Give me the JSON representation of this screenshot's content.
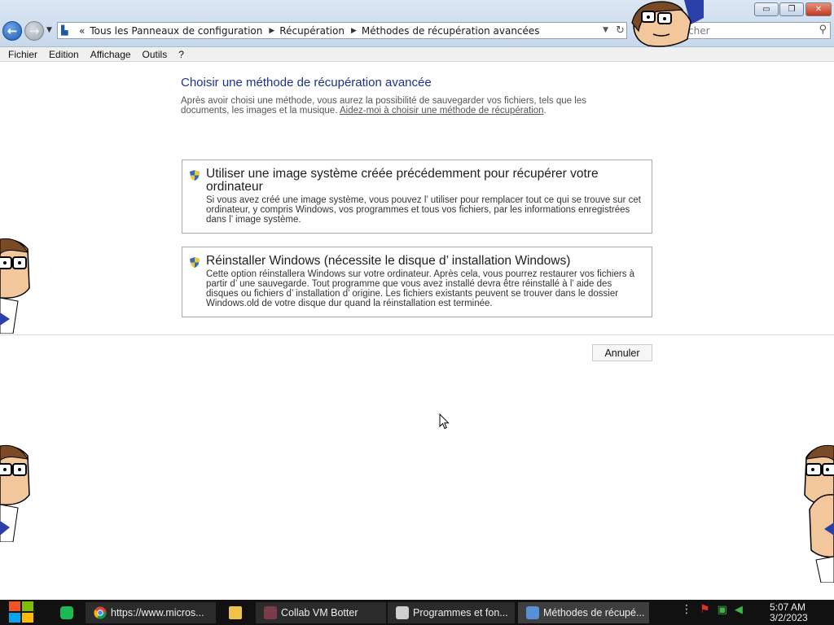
{
  "window": {
    "breadcrumb": {
      "prefix": "«",
      "items": [
        "Tous les Panneaux de configuration",
        "Récupération",
        "Méthodes de récupération avancées"
      ]
    },
    "search_placeholder": "cher",
    "buttons": {
      "minimize": "▭",
      "maximize": "❐",
      "close": "✕"
    }
  },
  "menu": [
    "Fichier",
    "Edition",
    "Affichage",
    "Outils",
    "?"
  ],
  "page": {
    "heading": "Choisir une méthode de récupération avancée",
    "intro": "Après avoir choisi une méthode, vous aurez la possibilité de sauvegarder vos fichiers, tels que les documents, les images et la musique. ",
    "help_link": "Aidez-moi à choisir une méthode de récupération",
    "intro_end": ".",
    "options": [
      {
        "title": "Utiliser une image système créée précédemment pour récupérer votre ordinateur",
        "description": "Si vous avez créé une image système, vous pouvez l’ utiliser pour remplacer tout ce qui se trouve sur cet ordinateur, y compris Windows, vos programmes et tous vos fichiers, par les informations enregistrées dans l’ image système."
      },
      {
        "title": "Réinstaller Windows (nécessite le disque d’ installation Windows)",
        "description": "Cette option réinstallera Windows sur votre ordinateur. Après cela, vous pourrez restaurer vos fichiers à partir d’ une sauvegarde. Tout programme que vous avez installé devra être réinstallé à l’ aide des disques ou fichiers d’ installation d’ origine. Les fichiers existants peuvent se trouver dans le dossier Windows.old de votre disque dur quand la réinstallation est terminée."
      }
    ],
    "cancel_label": "Annuler"
  },
  "taskbar": {
    "apps": [
      {
        "label": "https://www.micros..."
      },
      {
        "label": "Collab VM Botter"
      },
      {
        "label": "Programmes et fon..."
      },
      {
        "label": "Méthodes de récupé..."
      }
    ],
    "clock": {
      "time": "5:07 AM",
      "date": "3/2/2023"
    }
  },
  "colors": {
    "heading": "#1e3287",
    "taskbar": "#111111",
    "close_button": "#c2391d"
  }
}
